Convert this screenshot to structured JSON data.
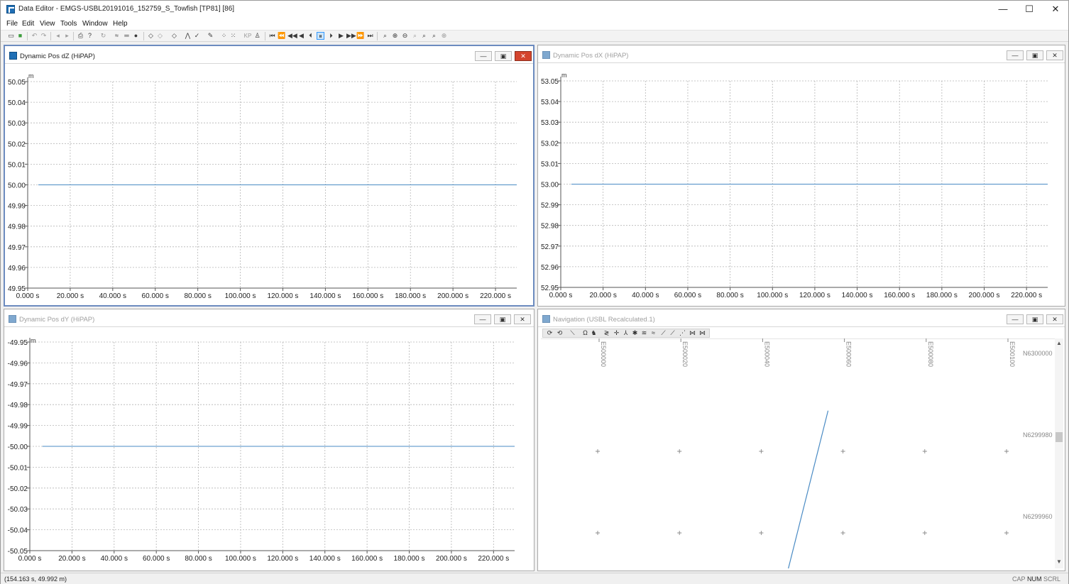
{
  "window": {
    "title": "Data Editor - EMGS-USBL20191016_152759_S_Towfish [TP81] [86]",
    "controls": {
      "minimize": "—",
      "maximize": "☐",
      "close": "✕"
    }
  },
  "menu": [
    "File",
    "Edit",
    "View",
    "Tools",
    "Window",
    "Help"
  ],
  "toolbar": {
    "icons": [
      "new-file-icon",
      "save-icon",
      "undo-icon",
      "redo-icon",
      "back-icon",
      "forward-icon",
      "print-icon",
      "help-icon",
      "refresh-icon",
      "waveform-icon",
      "line-icon",
      "filter-icon",
      "select-icon",
      "deselect-icon",
      "flag-icon",
      "spike-icon",
      "check-icon",
      "edit-icon",
      "scatter-icon",
      "scatter-alt-icon",
      "kp-icon",
      "person-icon",
      "first-icon",
      "prev-page-icon",
      "rewind-icon",
      "step-back-icon",
      "prev-frame-icon",
      "pause-icon",
      "next-frame-icon",
      "play-icon",
      "fast-forward-icon",
      "next-page-icon",
      "last-icon",
      "zoom-icon",
      "zoom-in-icon",
      "zoom-out-icon",
      "zoom-reset-icon",
      "zoom-fit-icon",
      "zoom-window-icon",
      "zoom-extents-icon"
    ],
    "kp_label": "KP"
  },
  "panels": {
    "dz": {
      "title": "Dynamic Pos dZ (HiPAP)",
      "unit": "m",
      "chart_data": {
        "type": "line",
        "xlabel": "",
        "ylabel": "m",
        "xlim": [
          0,
          230
        ],
        "ylim": [
          49.95,
          50.05
        ],
        "x_ticks": [
          "0.000 s",
          "20.000 s",
          "40.000 s",
          "60.000 s",
          "80.000 s",
          "100.000 s",
          "120.000 s",
          "140.000 s",
          "160.000 s",
          "180.000 s",
          "200.000 s",
          "220.000 s"
        ],
        "y_ticks": [
          "50.05",
          "50.04",
          "50.03",
          "50.02",
          "50.01",
          "50.00",
          "49.99",
          "49.98",
          "49.97",
          "49.96",
          "49.95"
        ],
        "series": [
          {
            "x": [
              5,
              230
            ],
            "y": [
              50.0,
              50.0
            ],
            "color": "#4a8bc4"
          }
        ]
      }
    },
    "dx": {
      "title": "Dynamic Pos dX (HiPAP)",
      "unit": "m",
      "chart_data": {
        "type": "line",
        "xlabel": "",
        "ylabel": "m",
        "xlim": [
          0,
          230
        ],
        "ylim": [
          52.95,
          53.05
        ],
        "x_ticks": [
          "0.000 s",
          "20.000 s",
          "40.000 s",
          "60.000 s",
          "80.000 s",
          "100.000 s",
          "120.000 s",
          "140.000 s",
          "160.000 s",
          "180.000 s",
          "200.000 s",
          "220.000 s"
        ],
        "y_ticks": [
          "53.05",
          "53.04",
          "53.03",
          "53.02",
          "53.01",
          "53.00",
          "52.99",
          "52.98",
          "52.97",
          "52.96",
          "52.95"
        ],
        "series": [
          {
            "x": [
              5,
              230
            ],
            "y": [
              53.0,
              53.0
            ],
            "color": "#4a8bc4"
          }
        ]
      }
    },
    "dy": {
      "title": "Dynamic Pos dY (HiPAP)",
      "unit": "m",
      "chart_data": {
        "type": "line",
        "xlabel": "",
        "ylabel": "m",
        "xlim": [
          0,
          230
        ],
        "ylim": [
          -50.05,
          -49.95
        ],
        "x_ticks": [
          "0.000 s",
          "20.000 s",
          "40.000 s",
          "60.000 s",
          "80.000 s",
          "100.000 s",
          "120.000 s",
          "140.000 s",
          "160.000 s",
          "180.000 s",
          "200.000 s",
          "220.000 s"
        ],
        "y_ticks": [
          "-49.95",
          "-49.96",
          "-49.97",
          "-49.98",
          "-49.99",
          "-50.00",
          "-50.01",
          "-50.02",
          "-50.03",
          "-50.04",
          "-50.05"
        ],
        "series": [
          {
            "x": [
              6,
              230
            ],
            "y": [
              -50.0,
              -50.0
            ],
            "color": "#4a8bc4"
          }
        ]
      }
    },
    "nav": {
      "title": "Navigation (USBL Recalculated.1)",
      "toolbar_icons": [
        "rotate-icon",
        "rotate-back-icon",
        "measure-icon",
        "lasso-icon",
        "walk-icon",
        "layers-icon",
        "crosshair-icon",
        "route-icon",
        "snow-icon",
        "grid-icon",
        "wave-icon",
        "track-icon",
        "track-alt-icon",
        "track-dotted-icon",
        "fish-icon",
        "fish-alt-icon"
      ],
      "easting_labels": [
        "E500000",
        "E500020",
        "E500040",
        "E500060",
        "E500080",
        "E500100"
      ],
      "northing_labels": [
        "N6300000",
        "N6299980",
        "N6299960"
      ],
      "track": {
        "from": [
          500056,
          6299983
        ],
        "to": [
          500046,
          6299951
        ]
      }
    }
  },
  "status": {
    "position": "(154.163 s, 49.992 m)",
    "cap": "CAP",
    "num": "NUM",
    "scrl": "SCRL"
  }
}
